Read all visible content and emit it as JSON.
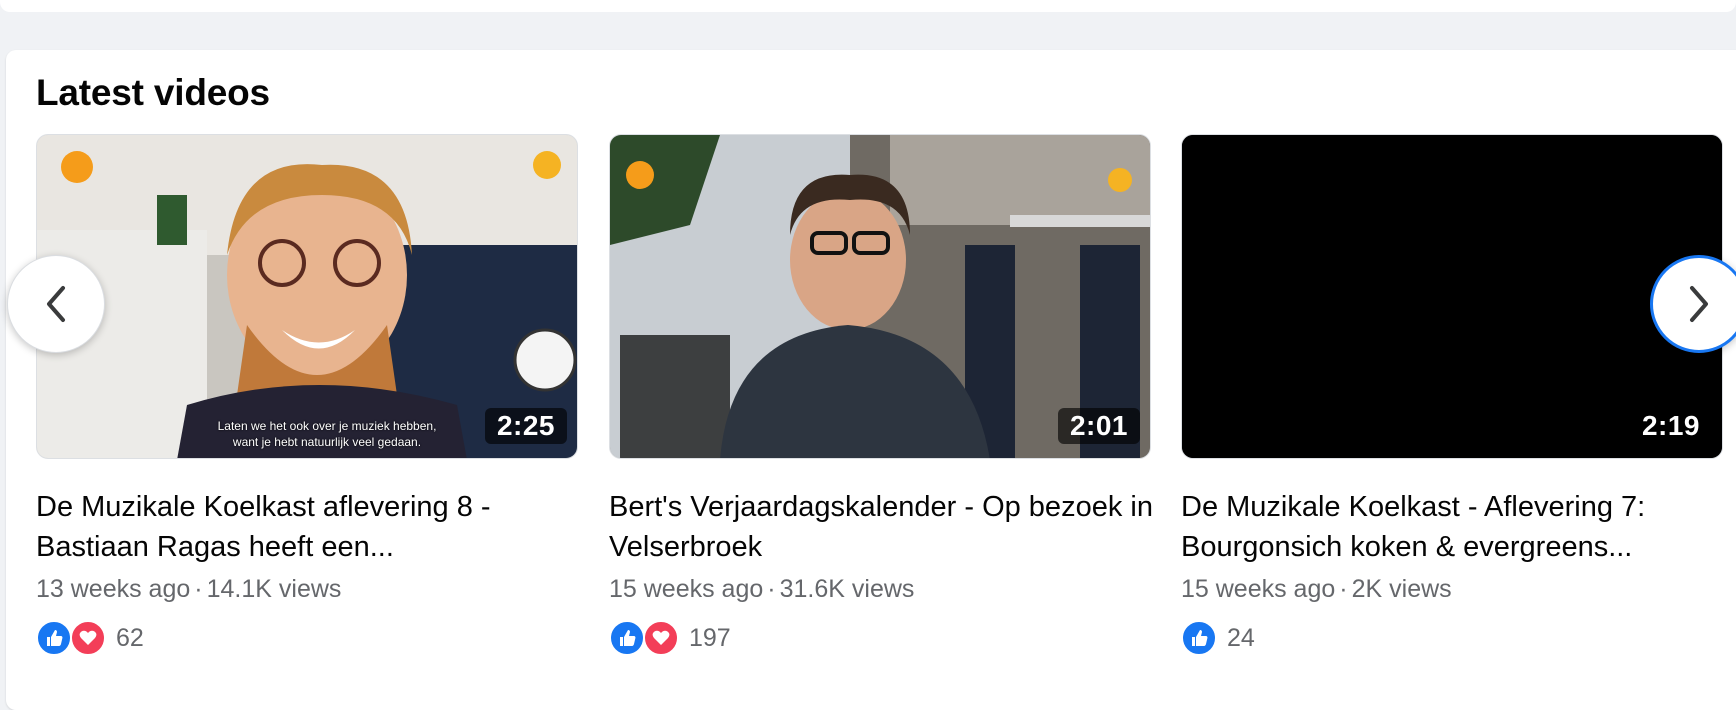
{
  "section": {
    "title": "Latest videos"
  },
  "videos": [
    {
      "duration": "2:25",
      "subtitle_line1": "Laten we het ook over je muziek hebben,",
      "subtitle_line2": "want je hebt natuurlijk veel gedaan.",
      "title": "De Muzikale Koelkast aflevering 8 - Bastiaan Ragas heeft een...",
      "age": "13 weeks ago",
      "views": "14.1K views",
      "reactions": [
        "like-icon",
        "love-icon"
      ],
      "reaction_count": "62"
    },
    {
      "duration": "2:01",
      "title": "Bert's Verjaardagskalender - Op bezoek in Velserbroek",
      "age": "15 weeks ago",
      "views": "31.6K views",
      "reactions": [
        "like-icon",
        "love-icon"
      ],
      "reaction_count": "197"
    },
    {
      "duration": "2:19",
      "title": "De Muzikale Koelkast - Aflevering 7: Bourgonsich koken & evergreens...",
      "age": "15 weeks ago",
      "views": "2K views",
      "reactions": [
        "like-icon"
      ],
      "reaction_count": "24"
    }
  ],
  "separator": "·",
  "navigation": {
    "prev_icon": "chevron-left-icon",
    "next_icon": "chevron-right-icon"
  },
  "colors": {
    "accent": "#1877f2",
    "love": "#f33e58",
    "meta_text": "#65676b"
  }
}
